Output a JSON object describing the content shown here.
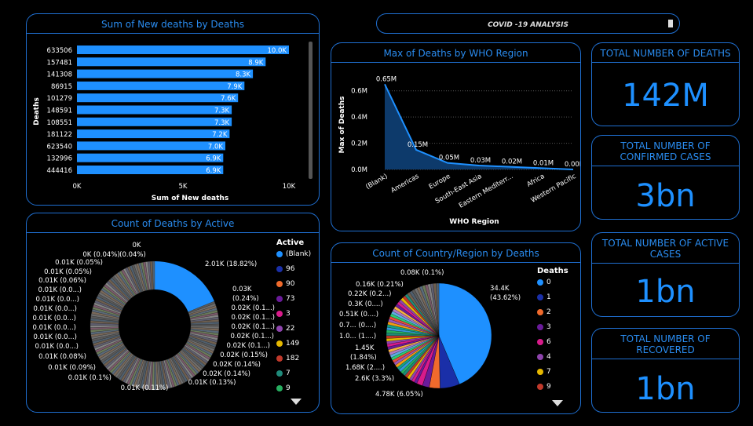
{
  "header": {
    "title": "COVID -19 ANALYSIS"
  },
  "panels": {
    "bar": {
      "title": "Sum of New deaths by Deaths"
    },
    "area": {
      "title": "Max of Deaths by WHO Region"
    },
    "donut": {
      "title": "Count of Deaths by Active"
    },
    "pie": {
      "title": "Count of Country/Region by Deaths"
    }
  },
  "kpis": [
    {
      "title": "TOTAL NUMBER OF DEATHS",
      "value": "142M"
    },
    {
      "title": "TOTAL NUMBER OF CONFIRMED CASES",
      "value": "3bn"
    },
    {
      "title": "TOTAL NUMBER OF ACTIVE CASES",
      "value": "1bn"
    },
    {
      "title": "TOTAL NUMBER OF RECOVERED",
      "value": "1bn"
    }
  ],
  "colors": {
    "accent": "#1e90ff",
    "border": "#1f6fd1",
    "bar": "#1e90ff"
  },
  "chart_data": [
    {
      "type": "bar",
      "title": "Sum of New deaths by Deaths",
      "ylabel": "Deaths",
      "xlabel": "Sum of New deaths",
      "categories": [
        "633506",
        "157481",
        "141308",
        "86915",
        "101279",
        "148591",
        "108551",
        "181122",
        "623540",
        "132996",
        "444416"
      ],
      "values": [
        10000,
        8900,
        8300,
        7900,
        7600,
        7300,
        7300,
        7200,
        7000,
        6900,
        6900
      ],
      "data_labels": [
        "10.0K",
        "8.9K",
        "8.3K",
        "7.9K",
        "7.6K",
        "7.3K",
        "7.3K",
        "7.2K",
        "7.0K",
        "6.9K",
        "6.9K"
      ],
      "xticks": [
        "0K",
        "5K",
        "10K"
      ],
      "xlim": [
        0,
        10000
      ]
    },
    {
      "type": "area",
      "title": "Max of Deaths by WHO Region",
      "ylabel": "Max of Deaths",
      "xlabel": "WHO Region",
      "categories": [
        "(Blank)",
        "Americas",
        "Europe",
        "South-East Asia",
        "Eastern Mediterr...",
        "Africa",
        "Western Pacific"
      ],
      "values": [
        0.65,
        0.15,
        0.05,
        0.03,
        0.02,
        0.01,
        0.0
      ],
      "data_labels": [
        "0.65M",
        "0.15M",
        "0.05M",
        "0.03M",
        "0.02M",
        "0.01M",
        "0.00M"
      ],
      "yticks": [
        "0.0M",
        "0.2M",
        "0.4M",
        "0.6M"
      ],
      "ylim": [
        0,
        0.7
      ],
      "grid": true
    },
    {
      "type": "pie",
      "variant": "donut",
      "title": "Count of Deaths by Active",
      "legend_title": "Active",
      "legend": [
        {
          "label": "(Blank)",
          "color": "#1e90ff"
        },
        {
          "label": "96",
          "color": "#1a2fa8"
        },
        {
          "label": "90",
          "color": "#f06a2c"
        },
        {
          "label": "73",
          "color": "#6a1b9a"
        },
        {
          "label": "3",
          "color": "#d81b8a"
        },
        {
          "label": "22",
          "color": "#8e44ad"
        },
        {
          "label": "149",
          "color": "#e6b800"
        },
        {
          "label": "182",
          "color": "#c0392b"
        },
        {
          "label": "7",
          "color": "#1f8a7a"
        },
        {
          "label": "9",
          "color": "#27ae60"
        }
      ],
      "highlight_share": 0.1882,
      "labels": [
        "0K",
        "0K (0.04%)",
        "(0.04%)",
        "0.01K (0.05%)",
        "0.01K (0.05%)",
        "0.01K (0.06%)",
        "0.01K (0.0...)",
        "0.01K (0.0...)",
        "0.01K (0.0...)",
        "0.01K (0.0...)",
        "0.01K (0.0...)",
        "0.01K (0.0...)",
        "0.01K (0.0...)",
        "0.01K (0.08%)",
        "0.01K (0.09%)",
        "0.01K (0.1%)",
        "0.01K (0.11%)",
        "0.01K (0.13%)",
        "0.02K (0.14%)",
        "0.02K (0.14%)",
        "0.02K (0.15%)",
        "0.02K (0.1...)",
        "0.02K (0.1...)",
        "0.02K (0.1...)",
        "0.02K (0.1...)",
        "0.02K (0.1...)",
        "0.03K",
        "(0.24%)",
        "2.01K (18.82%)"
      ]
    },
    {
      "type": "pie",
      "title": "Count of Country/Region by Deaths",
      "legend_title": "Deaths",
      "legend": [
        {
          "label": "0",
          "color": "#1e90ff"
        },
        {
          "label": "1",
          "color": "#1a2fa8"
        },
        {
          "label": "2",
          "color": "#f06a2c"
        },
        {
          "label": "3",
          "color": "#6a1b9a"
        },
        {
          "label": "6",
          "color": "#d81b8a"
        },
        {
          "label": "4",
          "color": "#8e44ad"
        },
        {
          "label": "7",
          "color": "#e6b800"
        },
        {
          "label": "9",
          "color": "#c0392b"
        }
      ],
      "slices": [
        {
          "label": "34.4K (43.62%)",
          "value": 43.62
        },
        {
          "label": "4.78K (6.05%)",
          "value": 6.05
        },
        {
          "label": "2.6K (3.3%)",
          "value": 3.3
        },
        {
          "label": "1.68K (2....)",
          "value": 2.13
        },
        {
          "label": "1.45K (1.84%)",
          "value": 1.84
        }
      ],
      "small_labels": [
        "1.0... (1....)",
        "0.7... (0....)",
        "0.51K (0....)",
        "0.3K (0....)",
        "0.22K (0.2...)",
        "0.16K (0.21%)",
        "0.08K (0.1%)"
      ]
    }
  ]
}
